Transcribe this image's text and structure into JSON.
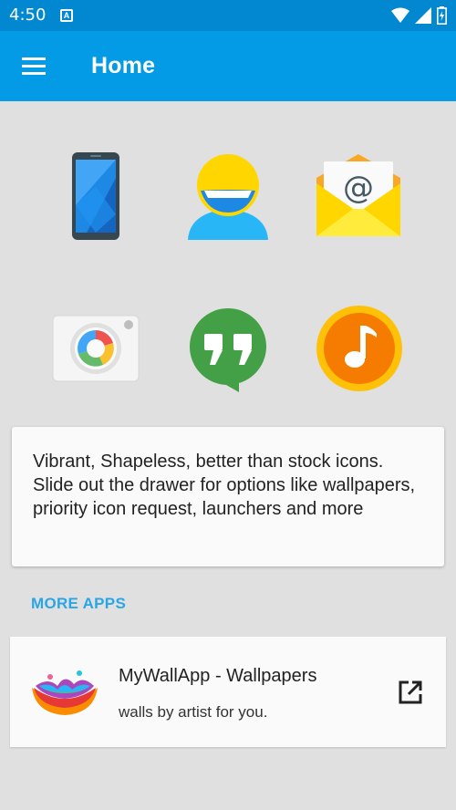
{
  "status_bar": {
    "time": "4:50",
    "a_badge": "A"
  },
  "app_bar": {
    "title": "Home",
    "menu_icon": "hamburger-menu-icon"
  },
  "icons": [
    {
      "name": "phone-icon"
    },
    {
      "name": "contacts-icon"
    },
    {
      "name": "email-icon"
    },
    {
      "name": "camera-icon"
    },
    {
      "name": "hangouts-icon"
    },
    {
      "name": "music-icon"
    }
  ],
  "description": "Vibrant, Shapeless, better than stock icons. Slide out the drawer for options like wallpapers, priority icon request, launchers and more",
  "more_apps": {
    "header": "MORE APPS",
    "items": [
      {
        "name": "MyWallApp - Wallpapers",
        "description": "walls by artist for you.",
        "action_icon": "open-in-new-icon"
      }
    ]
  },
  "colors": {
    "status_bar": "#0288d1",
    "app_bar": "#039be5",
    "accent": "#29a6e6",
    "background": "#e0e0e0"
  }
}
